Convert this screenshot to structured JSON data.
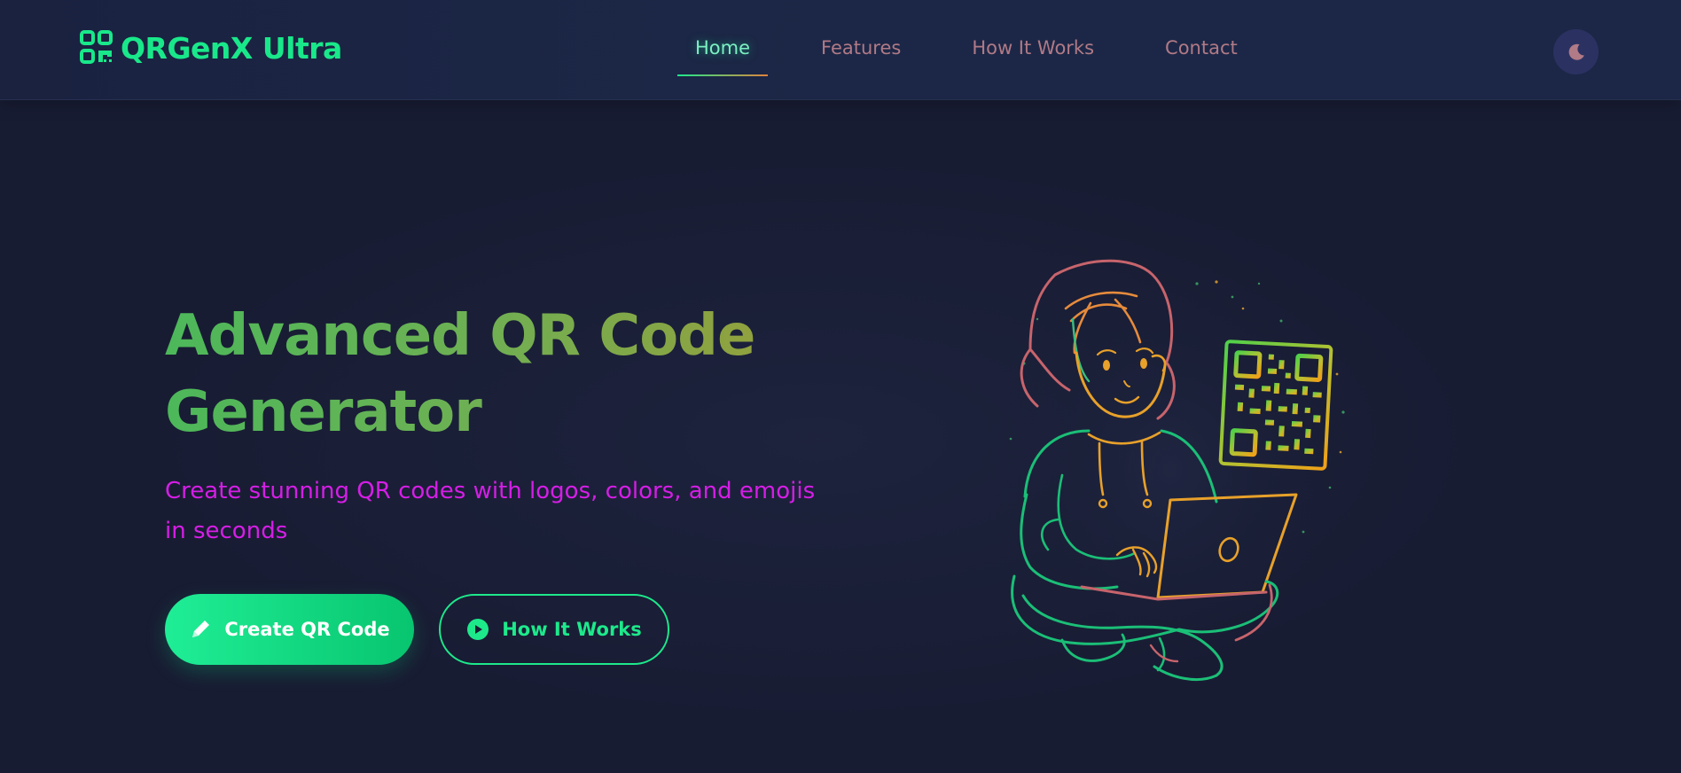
{
  "header": {
    "brand_name": "QRGenX Ultra",
    "brand_icon": "qrcode-icon",
    "nav": [
      {
        "label": "Home",
        "active": true
      },
      {
        "label": "Features",
        "active": false
      },
      {
        "label": "How It Works",
        "active": false
      },
      {
        "label": "Contact",
        "active": false
      }
    ],
    "theme_toggle_icon": "moon-icon"
  },
  "hero": {
    "title": "Advanced QR Code Generator",
    "subtitle": "Create stunning QR codes with logos, colors, and emojis in seconds",
    "primary_button": {
      "label": "Create QR Code",
      "icon": "pencil-icon"
    },
    "secondary_button": {
      "label": "How It Works",
      "icon": "play-circle-icon"
    },
    "illustration": "girl-with-laptop-and-qr-code-illustration"
  },
  "colors": {
    "background": "#181c33",
    "navbar": "#1c2747",
    "accent_green": "#1de98b",
    "nav_inactive": "#b07a86",
    "subtitle_magenta": "#d51ee6",
    "title_gradient_start": "#4cb85a",
    "title_gradient_end": "#9f9a36",
    "toggle_bg": "#2b3262"
  }
}
